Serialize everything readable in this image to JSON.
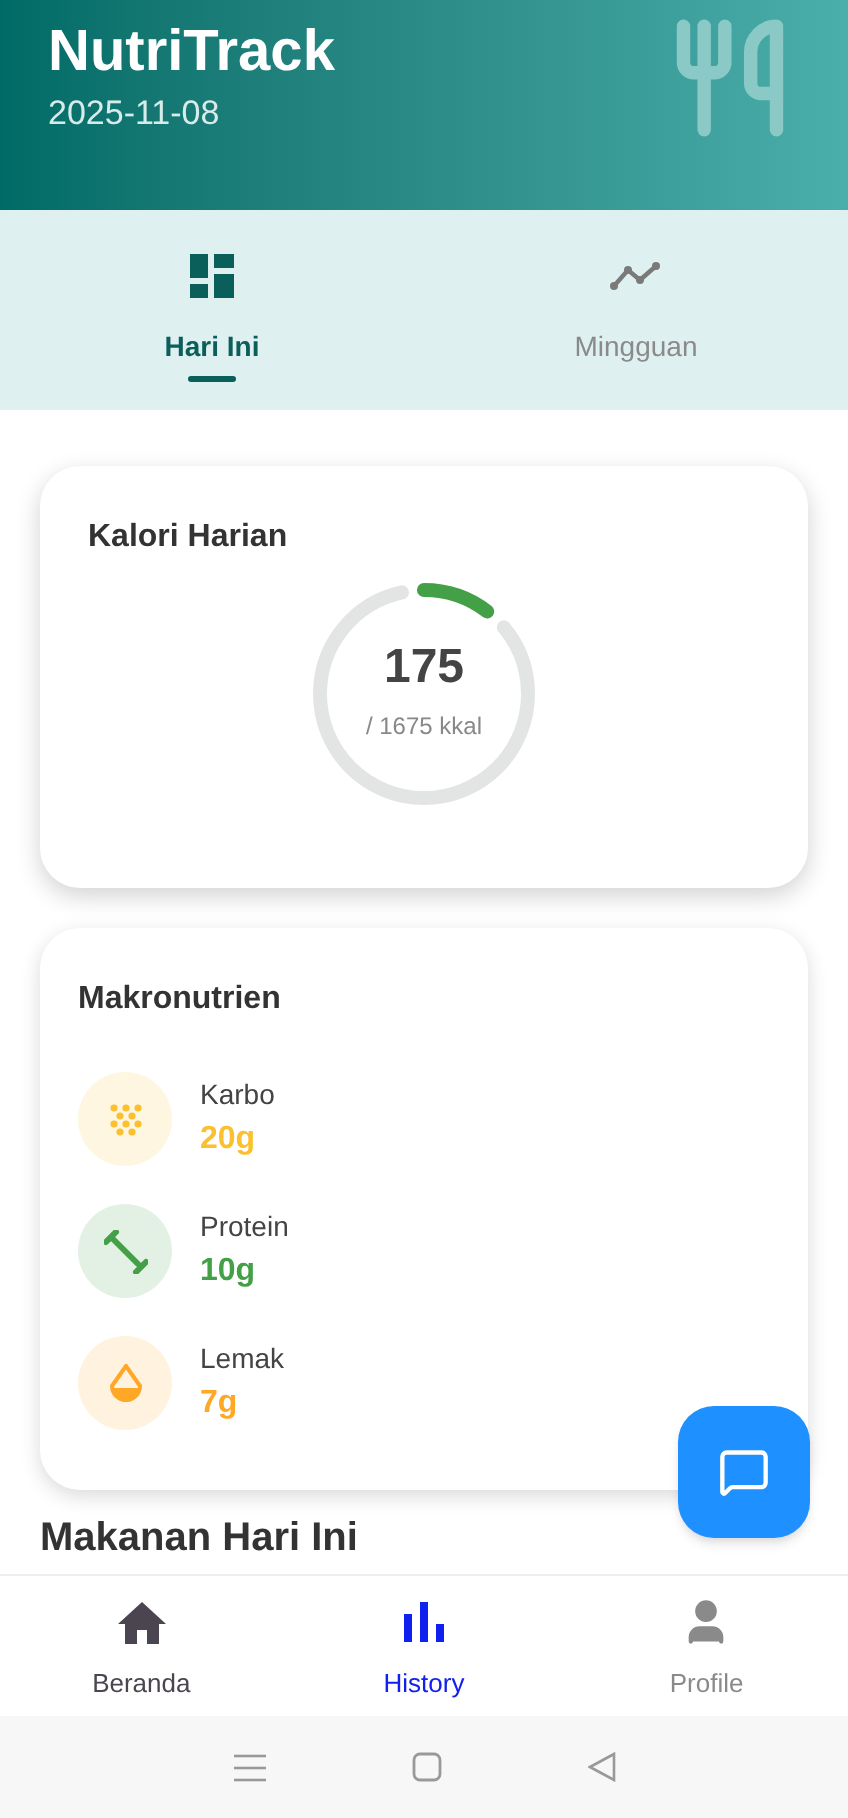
{
  "header": {
    "title": "NutriTrack",
    "date": "2025-11-08"
  },
  "tabs": [
    {
      "label": "Hari Ini",
      "kind": "dashboard",
      "selected": true
    },
    {
      "label": "Mingguan",
      "kind": "trend",
      "selected": false
    }
  ],
  "calories": {
    "title": "Kalori Harian",
    "value": "175",
    "target": "/ 1675 kkal"
  },
  "macros": {
    "title": "Makronutrien",
    "items": [
      {
        "kind": "carb",
        "name": "Karbo",
        "amount": "20g",
        "color": "#fbc02d"
      },
      {
        "kind": "protein",
        "name": "Protein",
        "amount": "10g",
        "color": "#43a047"
      },
      {
        "kind": "fat",
        "name": "Lemak",
        "amount": "7g",
        "color": "#ffa726"
      }
    ]
  },
  "meals_heading": "Makanan Hari Ini",
  "bottom_nav": [
    {
      "label": "Beranda",
      "kind": "home",
      "selected": false
    },
    {
      "label": "History",
      "kind": "history",
      "selected": true
    },
    {
      "label": "Profile",
      "kind": "profile",
      "selected": false
    }
  ]
}
